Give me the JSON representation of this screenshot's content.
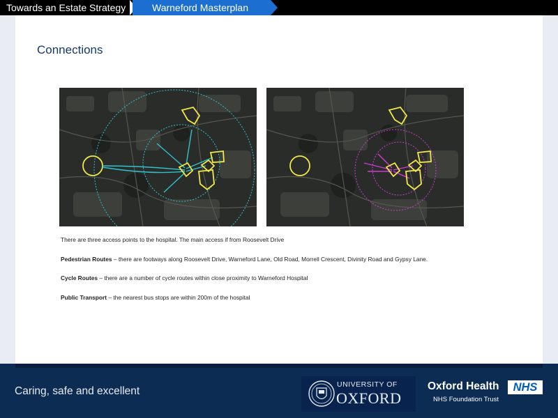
{
  "breadcrumb": {
    "first": "Towards an Estate Strategy",
    "second": "Warneford Masterplan"
  },
  "page_title": "Connections",
  "content": {
    "intro": "There are three access points to the hospital. The main access if from Roosevelt Drive",
    "pedestrian_label": "Pedestrian Routes",
    "pedestrian_text": " – there are footways along Roosevelt Drive, Warneford Lane, Old Road, Morrell Crescent, Divinity Road and Gypsy Lane.",
    "cycle_label": "Cycle Routes",
    "cycle_text": " – there are a number of cycle routes within close proximity to Warneford Hospital",
    "transport_label": "Public Transport",
    "transport_text": " – the nearest bus stops are within 200m of the hospital"
  },
  "footer": {
    "tagline": "Caring, safe and excellent",
    "university_line1": "UNIVERSITY OF",
    "university_line2": "OXFORD",
    "org_name": "Oxford Health",
    "org_trust": "NHS Foundation Trust",
    "nhs_badge": "NHS"
  },
  "colors": {
    "breadcrumb_active": "#1c6fd0",
    "footer_bg": "#0d2c54",
    "title": "#17386b",
    "map_highlight": "#f2e84a",
    "cycle_routes": "#2ec4cf",
    "pedestrian_routes": "#d23ad8"
  },
  "icons": {
    "university": "oxford-crest-icon",
    "nhs": "nhs-logo-icon"
  }
}
